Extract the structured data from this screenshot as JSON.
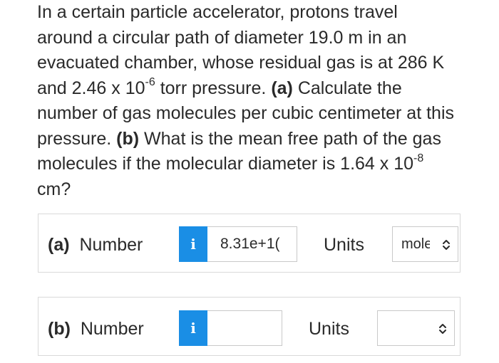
{
  "question": {
    "line1": "In a certain particle accelerator, protons travel",
    "line2": "around a circular path of diameter 19.0 m in an",
    "line3": "evacuated chamber, whose residual gas is at 286 K",
    "line4_pre": "and 2.46 x 10",
    "line4_exp": "-6",
    "line4_mid": " torr pressure. ",
    "line4_bold": "(a)",
    "line4_post": " Calculate the",
    "line5": "number of gas molecules per cubic centimeter at this",
    "line6_pre": "pressure. ",
    "line6_bold": "(b)",
    "line6_post": " What is the mean free path of the gas",
    "line7_pre": "molecules if the molecular diameter is 1.64 x 10",
    "line7_exp": "-8",
    "line8": "cm?"
  },
  "part_a": {
    "tag": "(a)",
    "number_label": "Number",
    "info_icon": "i",
    "number_value": "8.31e+1(",
    "units_label": "Units",
    "units_value": "mole"
  },
  "part_b": {
    "tag": "(b)",
    "number_label": "Number",
    "info_icon": "i",
    "number_value": "",
    "units_label": "Units",
    "units_value": ""
  },
  "colors": {
    "info_button": "#1a8ee5",
    "border": "#d9d9d9",
    "text": "#2a2a2a"
  }
}
